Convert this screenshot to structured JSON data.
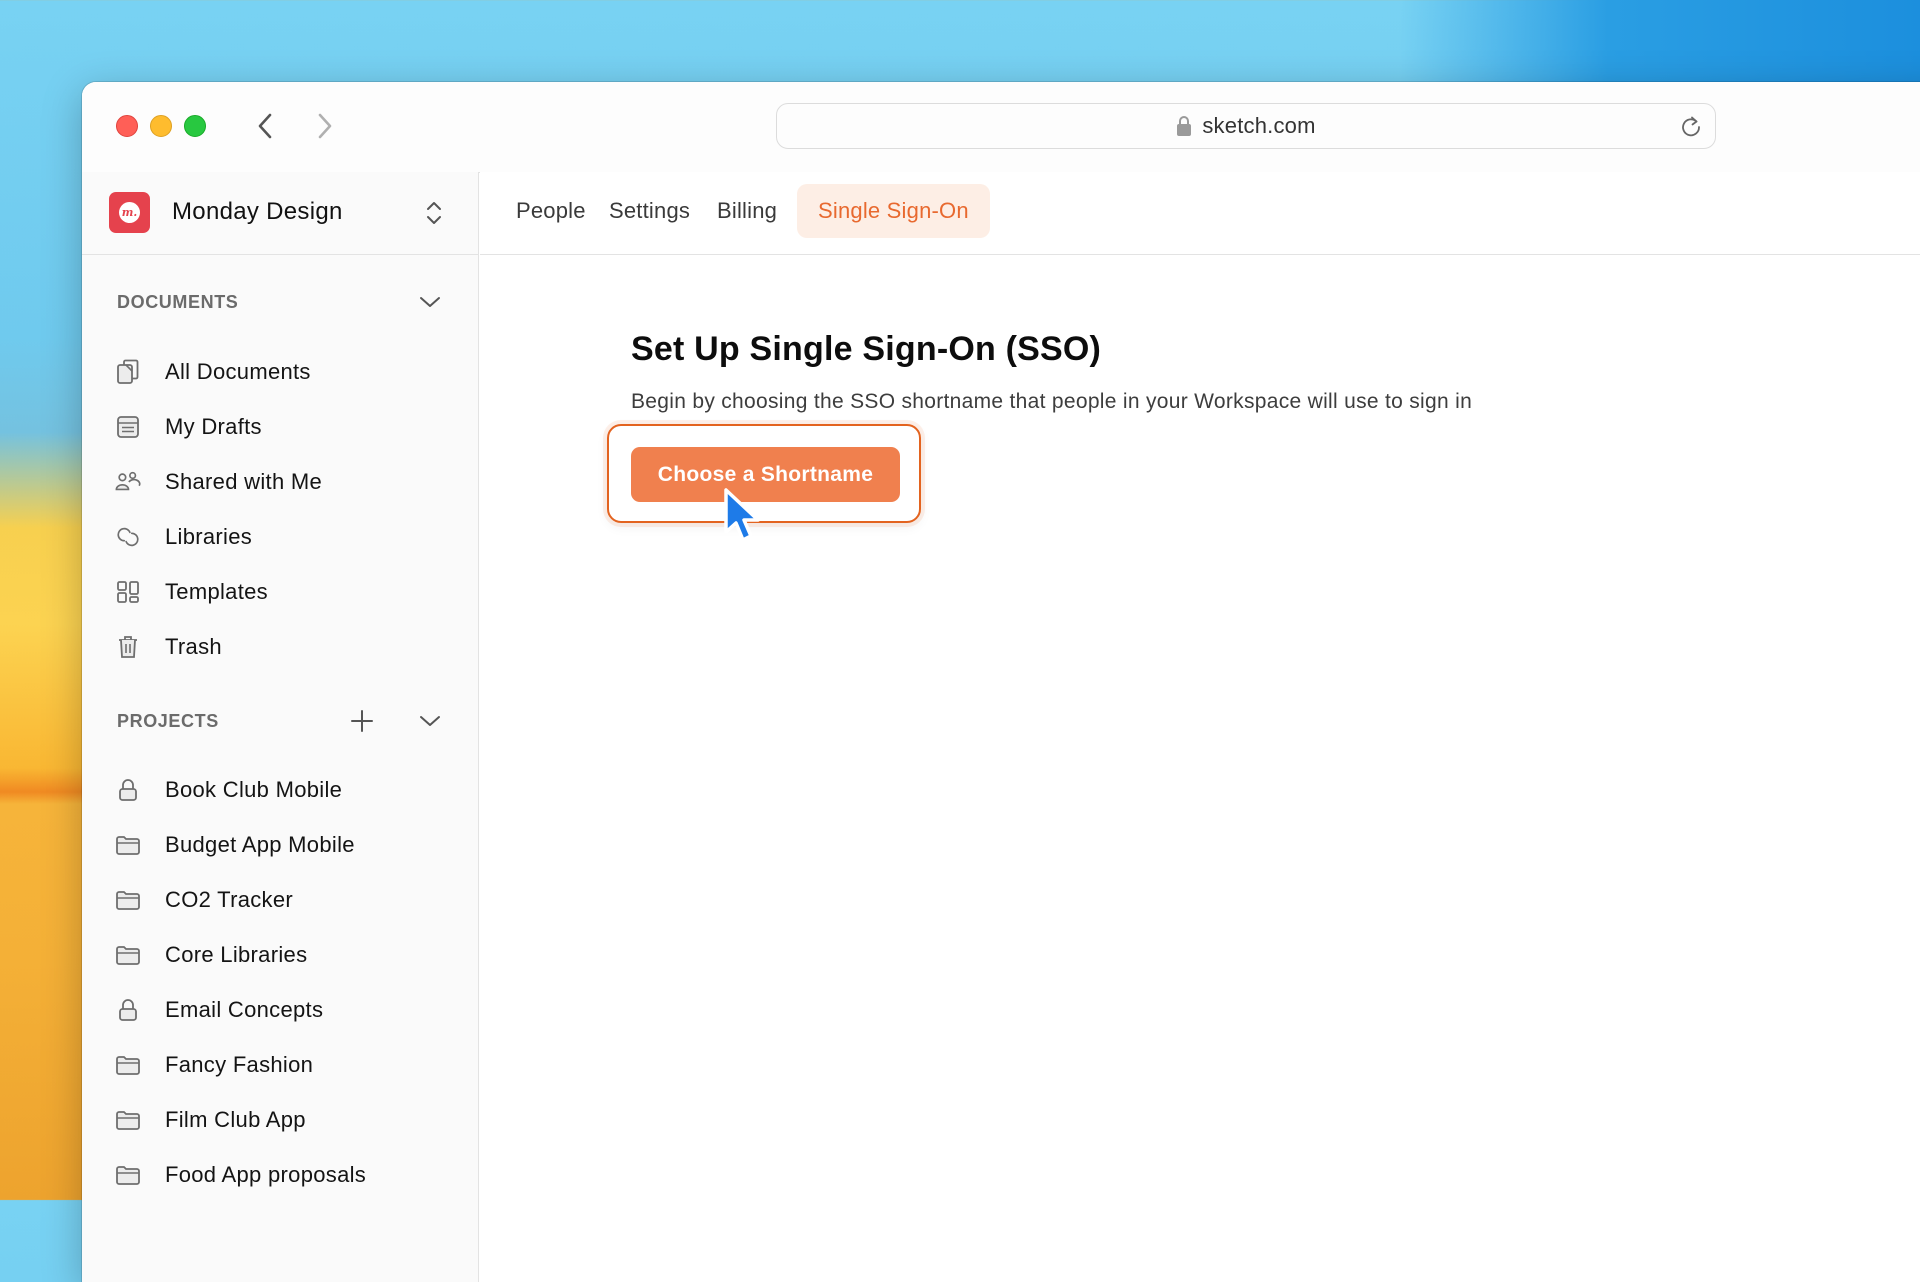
{
  "browser": {
    "url": "sketch.com",
    "back_icon": "chevron-left-icon",
    "forward_icon": "chevron-right-icon",
    "lock_icon": "lock-icon",
    "reload_icon": "reload-icon"
  },
  "workspace": {
    "name": "Monday Design",
    "logo_text": "m.",
    "logo_color": "#E5424D"
  },
  "sidebar": {
    "documents": {
      "heading": "DOCUMENTS",
      "items": [
        {
          "label": "All Documents",
          "icon": "documents-icon"
        },
        {
          "label": "My Drafts",
          "icon": "drafts-icon"
        },
        {
          "label": "Shared with Me",
          "icon": "people-icon"
        },
        {
          "label": "Libraries",
          "icon": "libraries-icon"
        },
        {
          "label": "Templates",
          "icon": "templates-icon"
        },
        {
          "label": "Trash",
          "icon": "trash-icon"
        }
      ]
    },
    "projects": {
      "heading": "PROJECTS",
      "items": [
        {
          "label": "Book Club Mobile",
          "icon": "lock-icon"
        },
        {
          "label": "Budget App Mobile",
          "icon": "folder-icon"
        },
        {
          "label": "CO2 Tracker",
          "icon": "folder-icon"
        },
        {
          "label": "Core Libraries",
          "icon": "folder-icon"
        },
        {
          "label": "Email Concepts",
          "icon": "lock-icon"
        },
        {
          "label": "Fancy Fashion",
          "icon": "folder-icon"
        },
        {
          "label": "Film Club App",
          "icon": "folder-icon"
        },
        {
          "label": "Food App proposals",
          "icon": "folder-icon"
        }
      ]
    }
  },
  "tabs": [
    {
      "label": "People",
      "active": false
    },
    {
      "label": "Settings",
      "active": false
    },
    {
      "label": "Billing",
      "active": false
    },
    {
      "label": "Single Sign-On",
      "active": true
    }
  ],
  "content": {
    "title": "Set Up Single Sign-On (SSO)",
    "subtitle": "Begin by choosing the SSO shortname that people in your Workspace will use to sign in",
    "primary_button": "Choose a Shortname"
  },
  "colors": {
    "accent": "#E8692F",
    "button": "#F0804E",
    "active_tab_bg": "#FDEEE5",
    "cursor": "#1E7BE8"
  }
}
